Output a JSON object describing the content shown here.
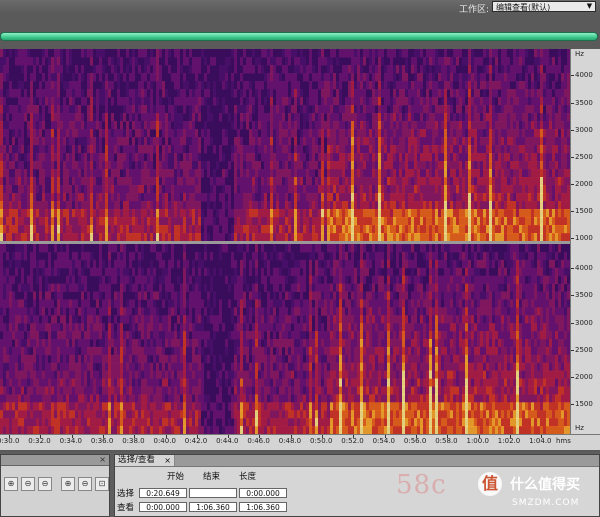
{
  "workspace": {
    "label": "工作区:",
    "value": "编辑查看(默认)"
  },
  "frequency_ruler": {
    "unit": "Hz",
    "upper": [
      "4000",
      "3500",
      "3000",
      "2500",
      "2000",
      "1500",
      "1000"
    ],
    "lower": [
      "4000",
      "3500",
      "3000",
      "2500",
      "2000",
      "1500"
    ],
    "unit_bottom": "Hz"
  },
  "time_ruler": {
    "labels": [
      "0:30.0",
      "0:32.0",
      "0:34.0",
      "0:36.0",
      "0:38.0",
      "0:40.0",
      "0:42.0",
      "0:44.0",
      "0:46.0",
      "0:48.0",
      "0:50.0",
      "0:52.0",
      "0:54.0",
      "0:56.0",
      "0:58.0",
      "1:00.0",
      "1:02.0",
      "1:04.0"
    ],
    "unit": "hms"
  },
  "selection_panel": {
    "tab": "选择/查看",
    "columns": {
      "start": "开始",
      "end": "结束",
      "length": "长度"
    },
    "rows": [
      {
        "label": "选择",
        "start": "0:20.649",
        "end": "",
        "length": "0:00.000"
      },
      {
        "label": "查看",
        "start": "0:00.000",
        "end": "1:06.360",
        "length": "1:06.360"
      }
    ]
  },
  "zoom_panel": {
    "buttons": [
      "zoom-in-full",
      "zoom-out-left",
      "zoom-out-right",
      "zoom-in-amplitude",
      "zoom-out-amplitude",
      "zoom-selection"
    ]
  },
  "watermark": {
    "text": "58c",
    "logo": "值",
    "brand": "什么值得买",
    "site": "SMZDM.COM"
  },
  "colors": {
    "spectrum_bg": "#3a0d5c",
    "progress": "#3ec98e"
  }
}
